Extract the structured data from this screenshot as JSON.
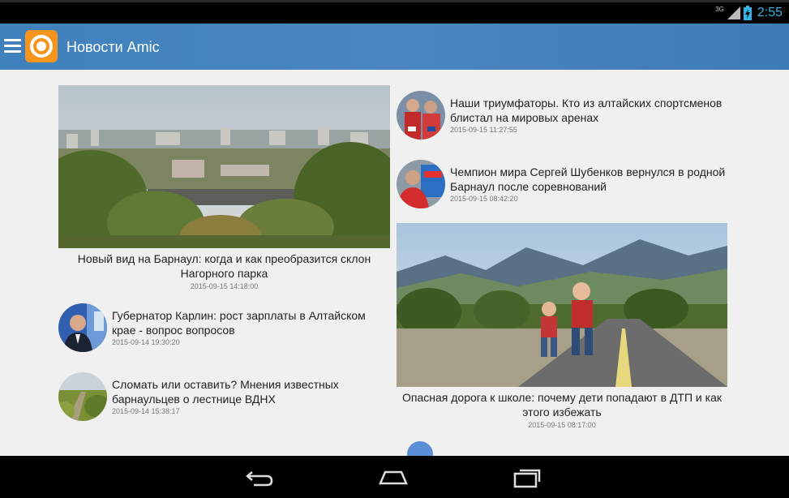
{
  "status": {
    "network": "3G",
    "time": "2:55"
  },
  "appbar": {
    "title": "Новости Amic"
  },
  "featured": [
    {
      "headline": "Новый вид на Барнаул: когда и как преобразится склон Нагорного парка",
      "date": "2015-09-15 14:18:00"
    },
    {
      "headline": "Опасная дорога к школе: почему дети попадают в ДТП и как этого избежать",
      "date": "2015-09-15 08:17:00"
    }
  ],
  "items": [
    {
      "headline": "Губернатор Карлин: рост зарплаты в Алтайском крае - вопрос вопросов",
      "date": "2015-09-14 19:30:20"
    },
    {
      "headline": "Сломать или оставить? Мнения известных барнаульцев о лестнице ВДНХ",
      "date": "2015-09-14 15:38:17"
    },
    {
      "headline": "Наши триумфаторы. Кто из алтайских спортсменов блистал на мировых аренах",
      "date": "2015-09-15 11:27:55"
    },
    {
      "headline": "Чемпион мира Сергей Шубенков вернулся в родной Барнаул после соревнований",
      "date": "2015-09-15 08:42:20"
    }
  ],
  "colors": {
    "appbar": "#4a86bf",
    "logo": "#f7941d",
    "status_accent": "#33b5e5"
  }
}
